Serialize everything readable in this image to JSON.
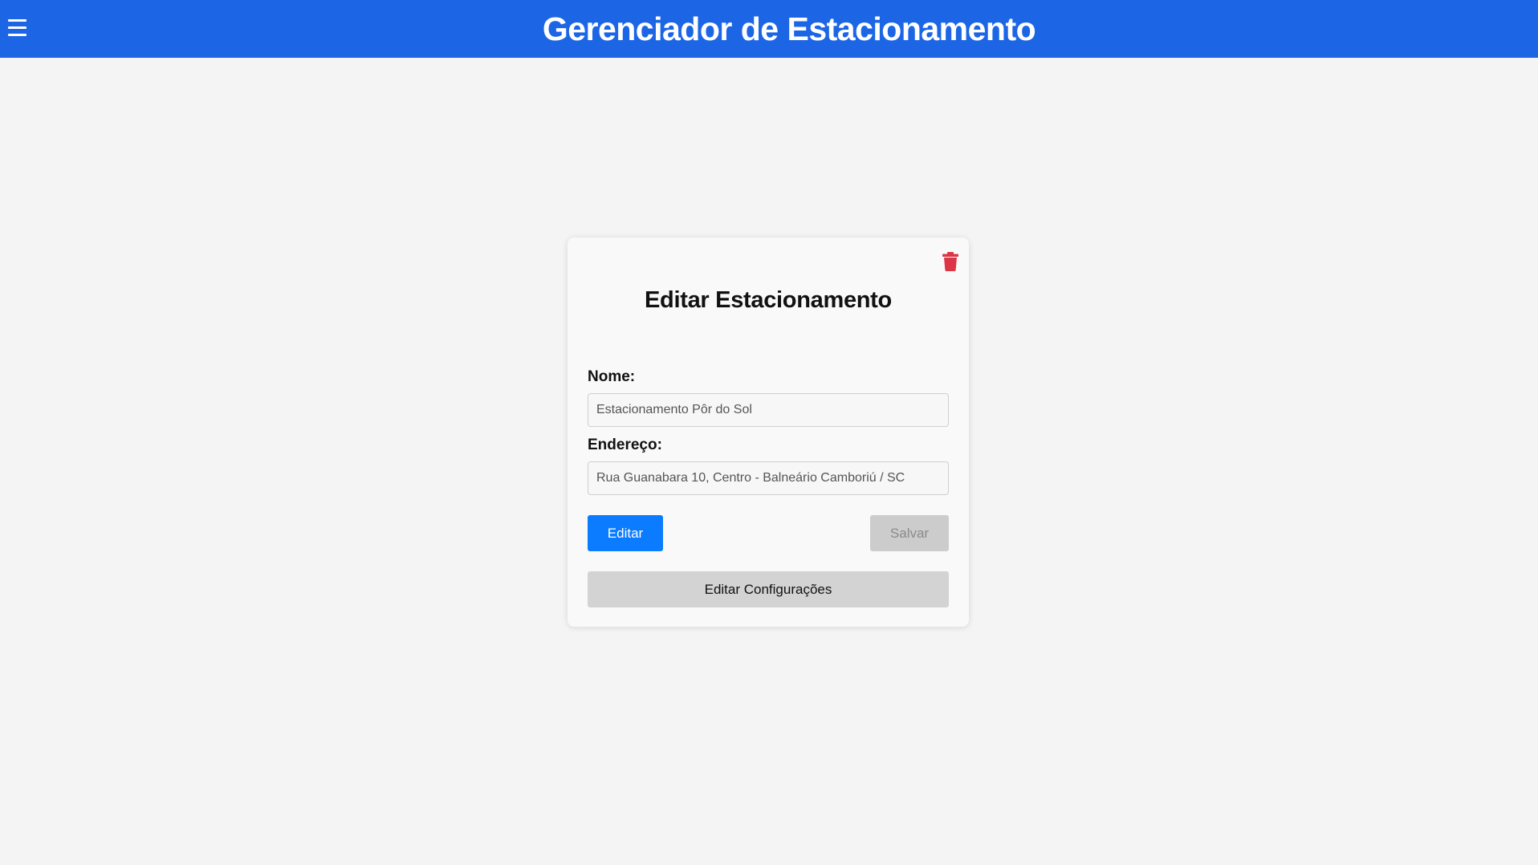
{
  "header": {
    "title": "Gerenciador de Estacionamento",
    "menu_icon": "hamburger-menu-icon",
    "background_color": "#1c66e6"
  },
  "card": {
    "title": "Editar Estacionamento",
    "delete_icon": "trash-icon",
    "delete_icon_color": "#dc3545",
    "fields": {
      "nome": {
        "label": "Nome:",
        "value": "Estacionamento Pôr do Sol"
      },
      "endereco": {
        "label": "Endereço:",
        "value": "Rua Guanabara 10, Centro - Balneário Camboriú / SC"
      }
    },
    "buttons": {
      "edit_label": "Editar",
      "save_label": "Salvar",
      "config_label": "Editar Configurações"
    }
  }
}
